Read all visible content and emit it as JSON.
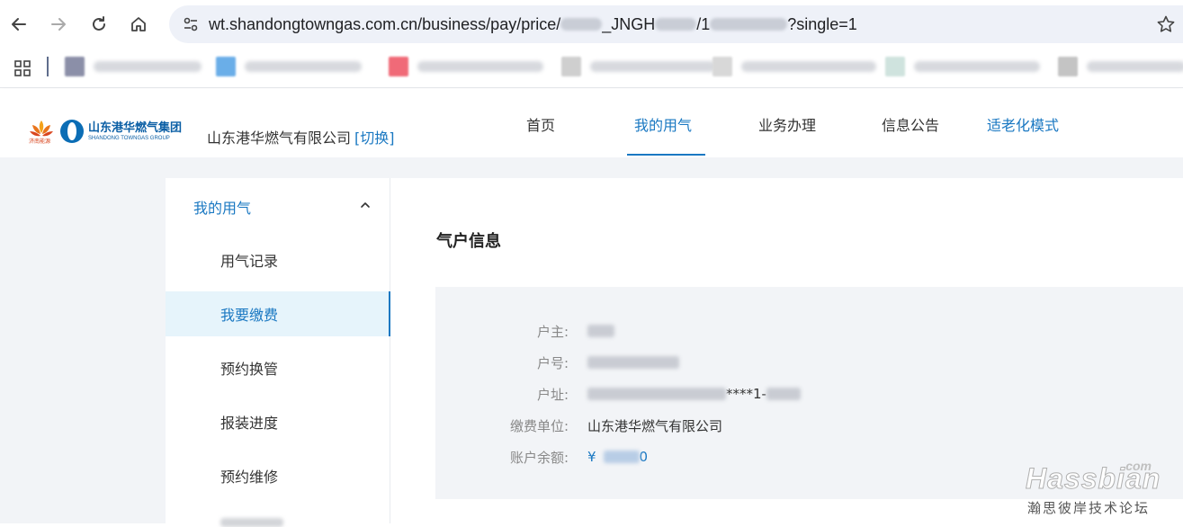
{
  "browser": {
    "url_start": "wt.shandongtowngas.com.cn/business/pay/price/",
    "url_mid": "_JNGH",
    "url_mid2": "/1",
    "url_end": "?single=1"
  },
  "site": {
    "logo_cn": "山东港华燃气集团",
    "logo_en": "SHANDONG TOWNGAS GROUP",
    "logo_lotus_text": "济南能源",
    "company_name": "山东港华燃气有限公司",
    "switch_label": "[切换]"
  },
  "mainnav": {
    "home": "首页",
    "my_gas": "我的用气",
    "business": "业务办理",
    "notice": "信息公告",
    "elderly_mode": "适老化模式"
  },
  "sidebar": {
    "group_label": "我的用气",
    "items": [
      {
        "label": "用气记录"
      },
      {
        "label": "我要缴费"
      },
      {
        "label": "预约换管"
      },
      {
        "label": "报装进度"
      },
      {
        "label": "预约维修"
      }
    ]
  },
  "account": {
    "title": "气户信息",
    "owner_label": "户主:",
    "number_label": "户号:",
    "address_label": "户址:",
    "address_visible": "****1-",
    "unit_label": "缴费单位:",
    "unit_value": "山东港华燃气有限公司",
    "balance_label": "账户余额:",
    "currency": "¥",
    "balance_tail": "0"
  },
  "watermark": {
    "com": ".com",
    "main": "Hassbian",
    "sub": "瀚思彼岸技术论坛"
  },
  "colors": {
    "accent": "#1a78c2",
    "active_bg": "#e6f4fb",
    "page_bg": "#f2f4f7"
  }
}
